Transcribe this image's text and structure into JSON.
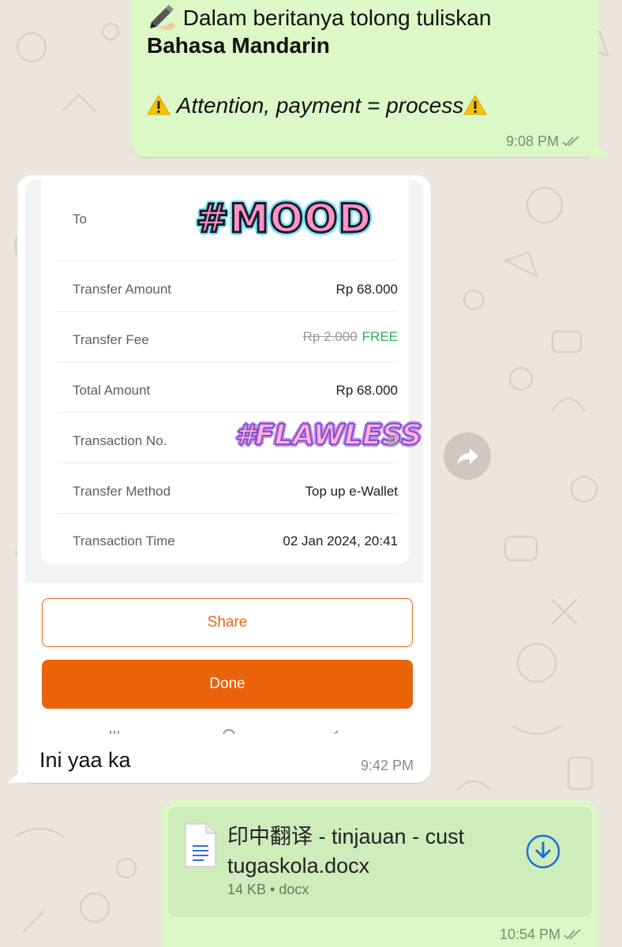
{
  "messages": {
    "out_top": {
      "line1": "Dalam beritanya tolong tuliskan",
      "line2": "Bahasa Mandarin",
      "line3": "Attention, payment = process",
      "time": "9:08 PM"
    },
    "in_image": {
      "caption": "Ini yaa ka",
      "time": "9:42 PM"
    },
    "out_doc": {
      "file_name_line1": "印中翻译 - tinjauan - cust",
      "file_name_line2": "tugaskola.docx",
      "file_size": "14 KB",
      "file_type": "docx",
      "time": "10:54 PM"
    }
  },
  "receipt": {
    "rows": [
      {
        "label": "To",
        "value": ""
      },
      {
        "label": "Transfer Amount",
        "value": "Rp 68.000"
      },
      {
        "label": "Transfer Fee",
        "value_old": "Rp 2.000",
        "value": "FREE"
      },
      {
        "label": "Total Amount",
        "value": "Rp 68.000"
      },
      {
        "label": "Transaction No.",
        "value": ""
      },
      {
        "label": "Transfer Method",
        "value": "Top up e-Wallet"
      },
      {
        "label": "Transaction Time",
        "value": "02 Jan 2024, 20:41"
      }
    ],
    "share_label": "Share",
    "done_label": "Done",
    "sticker_mood": "#MOOD",
    "sticker_flawless": "#FLAWLESS"
  },
  "colors": {
    "chat_bg": "#ebe5dd",
    "outgoing_bubble": "#dbf8c6",
    "accent_orange": "#ea630a",
    "free_green": "#2fae5a"
  },
  "icons": {
    "read_receipt": "double-check-icon",
    "forward": "forward-arrow-icon",
    "download": "download-icon",
    "document": "document-icon",
    "copy": "copy-icon"
  }
}
